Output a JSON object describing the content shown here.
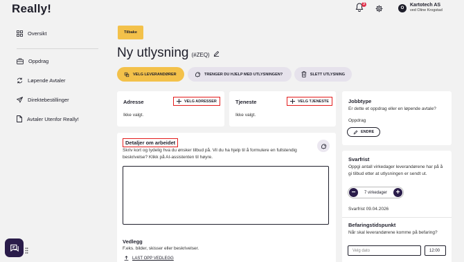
{
  "app": {
    "logo": "Really!"
  },
  "header": {
    "notification_count": "3",
    "account": {
      "initial": "O",
      "company": "Kartotech AS",
      "user": "ved Oline Krogstad"
    }
  },
  "sidebar": {
    "items": [
      {
        "label": "Oversikt",
        "icon": "grid-icon"
      },
      {
        "label": "Oppdrag",
        "icon": "briefcase-icon"
      },
      {
        "label": "Løpende Avtaler",
        "icon": "refresh-icon"
      },
      {
        "label": "Direktebestillinger",
        "icon": "send-icon"
      },
      {
        "label": "Avtaler Utenfor Really!",
        "icon": "document-icon"
      }
    ]
  },
  "page": {
    "back_label": "Tilbake",
    "title": "Ny utlysning",
    "id": "(#ZEQ)"
  },
  "actions": {
    "choose_suppliers": "VELG LEVERANDØRER",
    "need_help": "TRENGER DU HJELP MED UTLYSNINGEN?",
    "delete": "SLETT UTLYSNING"
  },
  "address": {
    "title": "Adresse",
    "button": "VELG ADRESSER",
    "value": "Ikke valgt."
  },
  "service": {
    "title": "Tjeneste",
    "button": "VELG TJENESTE",
    "value": "Ikke valgt."
  },
  "job_type": {
    "title": "Jobbtype",
    "question": "Er dette et oppdrag eller en løpende avtale?",
    "value": "Oppdrag",
    "change_button": "ENDRE"
  },
  "details": {
    "title": "Detaljer om arbeidet",
    "description": "Skriv kort og tydelig hva du ønsker tilbud på. Vil du ha hjelp til å formulere en fullstendig beskrivelse? Klikk på AI-assistenten til høyre.",
    "text_value": ""
  },
  "attachments": {
    "title": "Vedlegg",
    "description": "F.eks. bilder, skisser eller beskrivelser.",
    "upload_label": "LAST OPP VEDLEGG"
  },
  "deadline": {
    "title": "Svarfrist",
    "description": "Oppgi antall virkedager leverandørene har på å gi tilbud etter at utlysningen er sendt ut.",
    "value": "7 virkedager",
    "date_text": "Svarfrist 09.04.2026"
  },
  "inspection": {
    "title": "Befaringstidspunkt",
    "description": "Når skal leverandørene komme på befaring?",
    "date_placeholder": "Velg dato",
    "time_value": "12:00"
  },
  "colors": {
    "accent": "#f3c14a",
    "brand_dark": "#2a1c4a",
    "highlight": "#e31b1b",
    "badge": "#e0334d"
  }
}
